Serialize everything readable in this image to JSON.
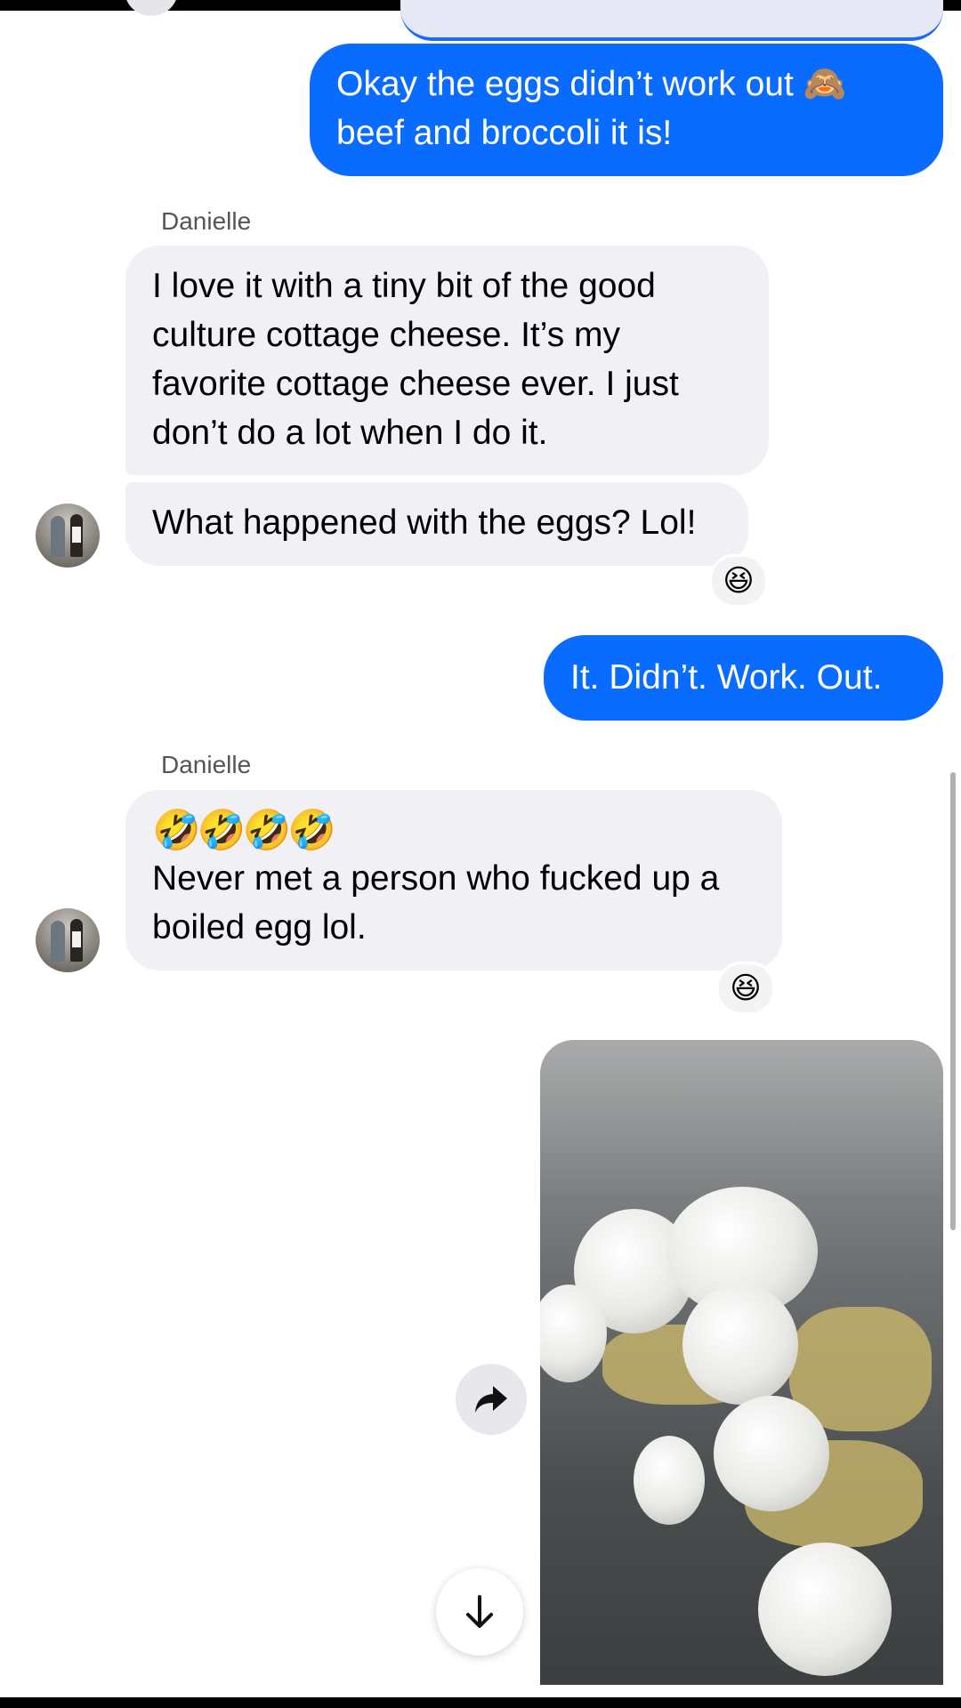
{
  "messages": [
    {
      "direction": "out",
      "text": "Okay the eggs didn’t work out 🙈 beef and broccoli it is!"
    },
    {
      "direction": "in",
      "sender": "Danielle",
      "text": "I love it with a tiny bit of the good culture cottage cheese. It’s my favorite cottage cheese ever. I just don’t do a lot when I do it."
    },
    {
      "direction": "in",
      "text": "What happened with the eggs? Lol!",
      "reaction": "😆"
    },
    {
      "direction": "out",
      "text": "It. Didn’t. Work. Out."
    },
    {
      "direction": "in",
      "sender": "Danielle",
      "text_line1": "🤣🤣🤣🤣",
      "text_line2": "Never met a person who fucked up a boiled egg lol.",
      "reaction": "😆"
    },
    {
      "direction": "out",
      "type": "photo",
      "description_icon": "photo-eggs"
    }
  ],
  "icons": {
    "forward": "forward-arrow-icon",
    "scroll_down": "arrow-down-icon"
  },
  "colors": {
    "outgoing_bubble": "#0a6cff",
    "incoming_bubble": "#f0f0f5"
  }
}
